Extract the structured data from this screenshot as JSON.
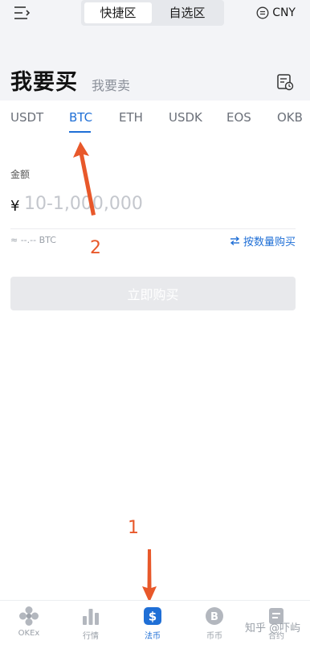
{
  "header": {
    "segments": [
      "快捷区",
      "自选区"
    ],
    "active_segment": "快捷区",
    "currency": "CNY"
  },
  "page": {
    "title": "我要买",
    "alt_title": "我要卖"
  },
  "tabs": [
    "USDT",
    "BTC",
    "ETH",
    "USDK",
    "EOS",
    "OKB"
  ],
  "active_tab": "BTC",
  "form": {
    "amount_label": "金额",
    "currency_symbol": "¥",
    "amount_placeholder": "10-1,000,000",
    "approx_text": "≈ --.-- BTC",
    "by_quantity_link": "按数量购买",
    "buy_button": "立即购买"
  },
  "annotations": [
    "1",
    "2"
  ],
  "bottom_nav": [
    {
      "label": "OKEx",
      "icon": "okex-logo-icon"
    },
    {
      "label": "行情",
      "icon": "market-chart-icon"
    },
    {
      "label": "法币",
      "icon": "fiat-dollar-icon",
      "active": true
    },
    {
      "label": "币币",
      "icon": "bitcoin-icon"
    },
    {
      "label": "合约",
      "icon": "contract-icon"
    }
  ],
  "watermark": "知乎 @吓屿",
  "colors": {
    "accent": "#1f6fd6",
    "annotation": "#e8582a",
    "header_bg": "#f3f4f7"
  }
}
